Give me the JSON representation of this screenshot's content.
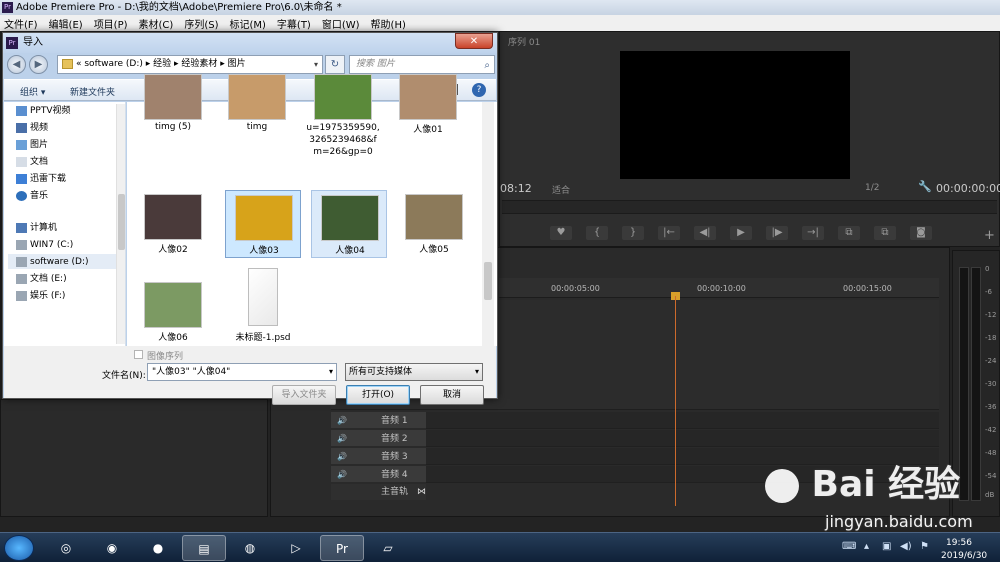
{
  "premiere": {
    "title": "Adobe Premiere Pro - D:\\我的文档\\Adobe\\Premiere Pro\\6.0\\未命名 *",
    "logo": "Pr",
    "menu": [
      "文件(F)",
      "编辑(E)",
      "项目(P)",
      "素材(C)",
      "序列(S)",
      "标记(M)",
      "字幕(T)",
      "窗口(W)",
      "帮助(H)"
    ],
    "program_monitor": {
      "tab": "序列 01",
      "timecode_left": "08:12",
      "fit": "适合",
      "fraction": "1/2",
      "timecode_right": "00:00:00:00"
    },
    "timeline": {
      "ruler_labels": [
        "00:00:05:00",
        "00:00:10:00",
        "00:00:15:00"
      ],
      "audio_tracks": [
        "音频 1",
        "音频 2",
        "音频 3",
        "音频 4"
      ],
      "master_track": "主音轨"
    },
    "meter_labels": [
      "0",
      "-6",
      "-12",
      "-18",
      "-24",
      "-30",
      "-36",
      "-42",
      "-48",
      "-54",
      "dB"
    ]
  },
  "dialog": {
    "title": "导入",
    "close_label": "✕",
    "address": "« software (D:) ▸ 经验 ▸ 经验素材 ▸ 图片",
    "search_placeholder": "搜索 图片",
    "toolbar": {
      "organize": "组织 ▾",
      "new_folder": "新建文件夹"
    },
    "nav_items": [
      "PPTV视频",
      "视频",
      "图片",
      "文档",
      "迅雷下载",
      "音乐",
      "计算机",
      "WIN7 (C:)",
      "software (D:)",
      "文档 (E:)",
      "娱乐 (F:)"
    ],
    "files": [
      {
        "name": "timg (5)",
        "color": "#a0826d"
      },
      {
        "name": "timg",
        "color": "#c79b6a"
      },
      {
        "name": "u=1975359590,\n3265239468&f\nm=26&gp=0",
        "color": "#5b8a3a"
      },
      {
        "name": "人像01",
        "color": "#b08d6e"
      },
      {
        "name": "人像02",
        "color": "#4a3a3a"
      },
      {
        "name": "人像03",
        "color": "#d7a31a"
      },
      {
        "name": "人像04",
        "color": "#3f5c32"
      },
      {
        "name": "人像05",
        "color": "#8c7a5a"
      },
      {
        "name": "人像06",
        "color": "#7c9a63"
      },
      {
        "name": "未标题-1.psd",
        "color": "#ffffff"
      }
    ],
    "image_sequence": "图像序列",
    "filename_label": "文件名(N):",
    "filename_value": "\"人像03\" \"人像04\"",
    "filetype": "所有可支持媒体",
    "buttons": {
      "import_folder": "导入文件夹",
      "open": "打开(O)",
      "cancel": "取消"
    }
  },
  "taskbar": {
    "time": "19:56",
    "date": "2019/6/30"
  },
  "watermark": {
    "brand": "Bai 经验",
    "url": "jingyan.baidu.com"
  }
}
